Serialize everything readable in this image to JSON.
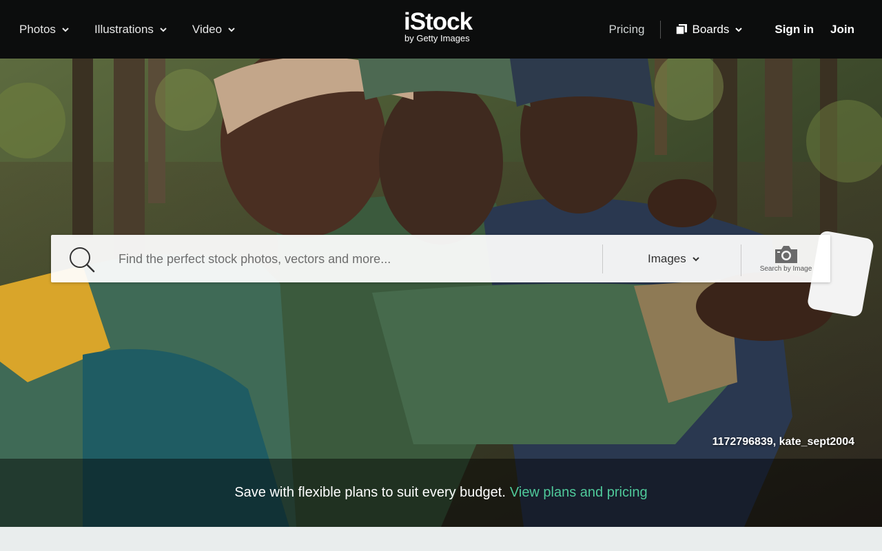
{
  "nav": {
    "photos": "Photos",
    "illustrations": "Illustrations",
    "video": "Video",
    "pricing": "Pricing",
    "boards": "Boards",
    "signin": "Sign in",
    "join": "Join"
  },
  "logo": {
    "main": "iStock",
    "sub": "by Getty Images"
  },
  "search": {
    "placeholder": "Find the perfect stock photos, vectors and more...",
    "media_type": "Images",
    "search_by_image": "Search by Image"
  },
  "hero": {
    "credit": "1172796839, kate_sept2004",
    "promo_text": "Save with flexible plans to suit every budget.",
    "promo_link": "View plans and pricing"
  },
  "colors": {
    "topbar": "#0c0d0d",
    "accent": "#4fc99a",
    "bottom_band": "#e9eded"
  },
  "icons": [
    "chevron-down-icon",
    "search-icon",
    "camera-icon",
    "boards-icon"
  ]
}
